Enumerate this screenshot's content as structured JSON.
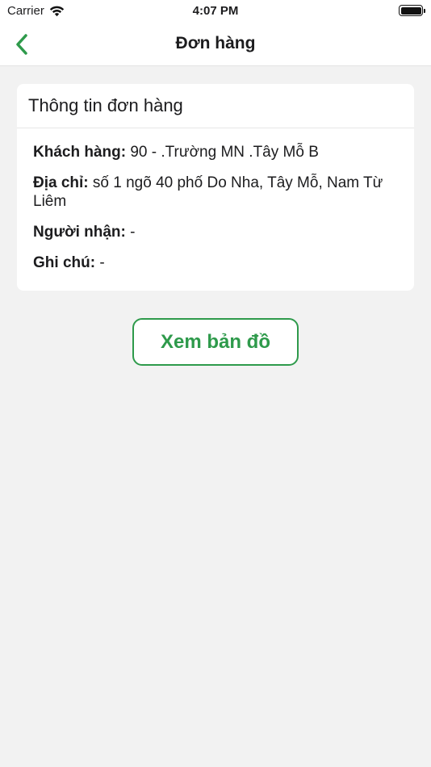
{
  "status_bar": {
    "carrier": "Carrier",
    "time": "4:07 PM"
  },
  "nav": {
    "title": "Đơn hàng",
    "back_icon": "chevron-left-icon",
    "accent_color": "#2e9a4b"
  },
  "order_info": {
    "header": "Thông tin đơn hàng",
    "customer": {
      "label": "Khách hàng:",
      "value": " 90 - .Trường MN .Tây Mỗ B"
    },
    "address": {
      "label": "Địa chỉ:",
      "value": " số 1 ngõ 40 phố Do Nha, Tây Mỗ, Nam Từ Liêm"
    },
    "recipient": {
      "label": "Người nhận:",
      "value": " -"
    },
    "note": {
      "label": "Ghi chú:",
      "value": " -"
    }
  },
  "actions": {
    "view_map_label": "Xem bản đồ"
  }
}
